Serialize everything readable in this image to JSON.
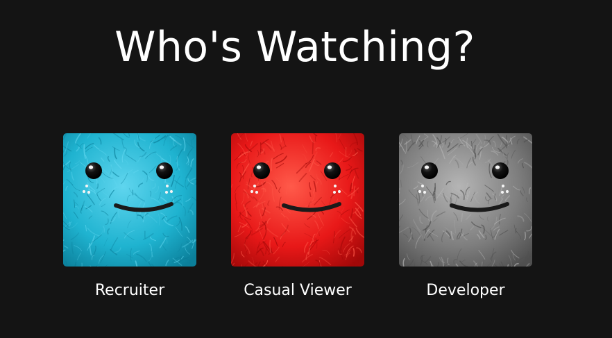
{
  "page": {
    "title": "Who's Watching?"
  },
  "profiles": [
    {
      "name": "Recruiter",
      "icon": "furry-monster-avatar-icon",
      "colors": {
        "base": "#1fb3d0",
        "light": "#5fd5ee",
        "dark": "#0b7f9a"
      }
    },
    {
      "name": "Casual Viewer",
      "icon": "furry-monster-avatar-icon",
      "colors": {
        "base": "#e81818",
        "light": "#ff5a4a",
        "dark": "#a10808"
      }
    },
    {
      "name": "Developer",
      "icon": "furry-monster-avatar-icon",
      "colors": {
        "base": "#7e7e7e",
        "light": "#b5b5b5",
        "dark": "#4f4f4f"
      }
    }
  ]
}
